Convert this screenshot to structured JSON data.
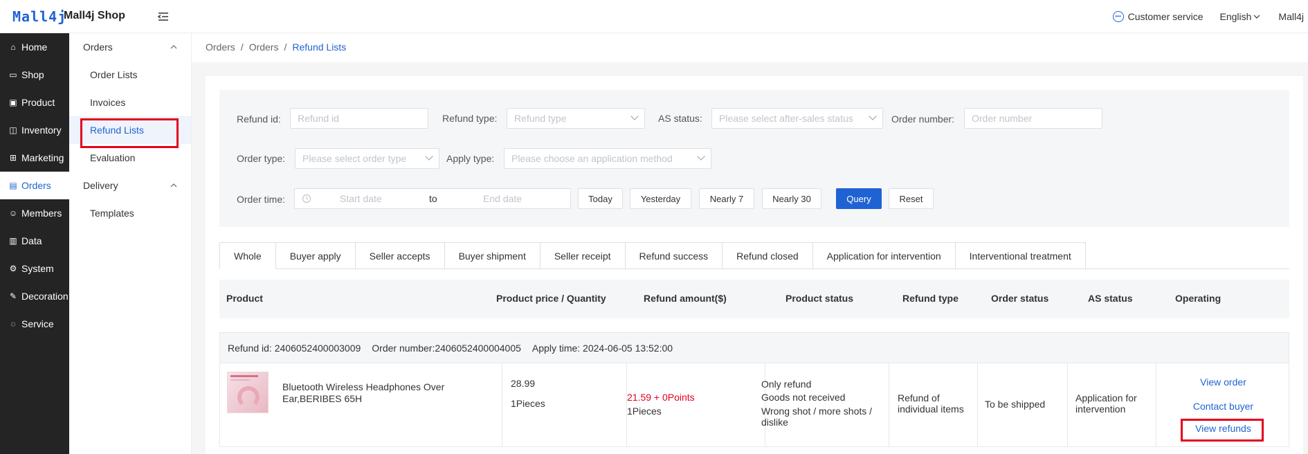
{
  "header": {
    "logo": "Mall4j",
    "shop_name": "Mall4j Shop",
    "customer_service": "Customer service",
    "language": "English",
    "user": "Mall4j"
  },
  "sidenav": [
    {
      "label": "Home",
      "icon": "home-icon"
    },
    {
      "label": "Shop",
      "icon": "shop-icon"
    },
    {
      "label": "Product",
      "icon": "product-icon"
    },
    {
      "label": "Inventory",
      "icon": "inventory-icon"
    },
    {
      "label": "Marketing",
      "icon": "marketing-icon"
    },
    {
      "label": "Orders",
      "icon": "orders-icon",
      "active": true
    },
    {
      "label": "Members",
      "icon": "members-icon"
    },
    {
      "label": "Data",
      "icon": "data-icon"
    },
    {
      "label": "System",
      "icon": "system-icon"
    },
    {
      "label": "Decoration",
      "icon": "decoration-icon"
    },
    {
      "label": "Service",
      "icon": "service-icon"
    }
  ],
  "subnav": {
    "group1": "Orders",
    "items1": [
      "Order Lists",
      "Invoices",
      "Refund Lists",
      "Evaluation"
    ],
    "group2": "Delivery",
    "items2": [
      "Templates"
    ]
  },
  "breadcrumb": [
    "Orders",
    "Orders",
    "Refund Lists"
  ],
  "filters": {
    "refund_id_label": "Refund id:",
    "refund_id_placeholder": "Refund id",
    "refund_type_label": "Refund type:",
    "refund_type_placeholder": "Refund type",
    "as_status_label": "AS status:",
    "as_status_placeholder": "Please select after-sales status",
    "order_number_label": "Order number:",
    "order_number_placeholder": "Order number",
    "order_type_label": "Order type:",
    "order_type_placeholder": "Please select order type",
    "apply_type_label": "Apply type:",
    "apply_type_placeholder": "Please choose an application method",
    "order_time_label": "Order time:",
    "start_placeholder": "Start date",
    "to": "to",
    "end_placeholder": "End date",
    "btn_today": "Today",
    "btn_yesterday": "Yesterday",
    "btn_nearly7": "Nearly 7",
    "btn_nearly30": "Nearly 30",
    "btn_query": "Query",
    "btn_reset": "Reset"
  },
  "tabs": [
    "Whole",
    "Buyer apply",
    "Seller accepts",
    "Buyer shipment",
    "Seller receipt",
    "Refund success",
    "Refund closed",
    "Application for intervention",
    "Interventional treatment"
  ],
  "table": {
    "headers": [
      "Product",
      "Product price / Quantity",
      "Refund amount($)",
      "Product status",
      "Refund type",
      "Order status",
      "AS status",
      "Operating"
    ]
  },
  "order": {
    "refund_id": "Refund id:  2406052400003009",
    "order_number": "Order number:2406052400004005",
    "apply_time": "Apply time:  2024-06-05 13:52:00",
    "product_name": "Bluetooth Wireless Headphones Over Ear,BERIBES 65H",
    "price": "28.99",
    "quantity": "1Pieces",
    "refund_amount": "21.59 + 0Points",
    "refund_qty": "1Pieces",
    "product_status": [
      "Only refund",
      "Goods not received",
      "Wrong shot / more shots / dislike"
    ],
    "refund_type": "Refund of individual items",
    "order_status": "To be shipped",
    "as_status": "Application for intervention",
    "ops": [
      "View order",
      "Contact buyer",
      "View refunds"
    ]
  }
}
